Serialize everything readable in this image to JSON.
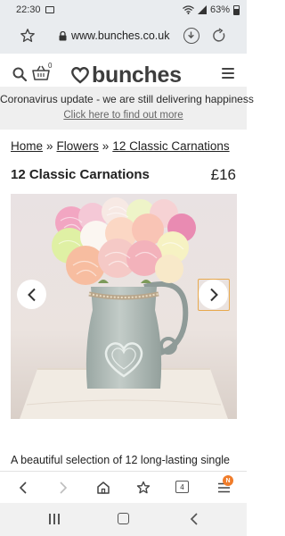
{
  "status_bar": {
    "time": "22:30",
    "battery": "63%"
  },
  "browser": {
    "url": "www.bunches.co.uk"
  },
  "site": {
    "logo_text": "bunches",
    "basket_count": "0"
  },
  "banner": {
    "title": "Coronavirus update - we are still delivering happiness",
    "link": "Click here to find out more"
  },
  "breadcrumb": {
    "items": [
      "Home",
      "Flowers",
      "12 Classic Carnations"
    ],
    "separator": "»"
  },
  "product": {
    "title": "12 Classic Carnations",
    "price": "£16",
    "description": "A beautiful selection of 12 long-lasting single"
  },
  "browser_nav": {
    "tabs_count": "4",
    "notification_badge": "N"
  },
  "icons": {
    "search": "search-icon",
    "basket": "basket-icon",
    "menu": "hamburger-menu-icon",
    "bookmark": "star-icon",
    "lock": "lock-icon",
    "download": "download-icon",
    "reload": "reload-icon"
  },
  "colors": {
    "accent": "#f07c2a",
    "focus_frame": "#e8a94e",
    "header_bg": "#e9ecef",
    "banner_bg": "#efefef"
  }
}
